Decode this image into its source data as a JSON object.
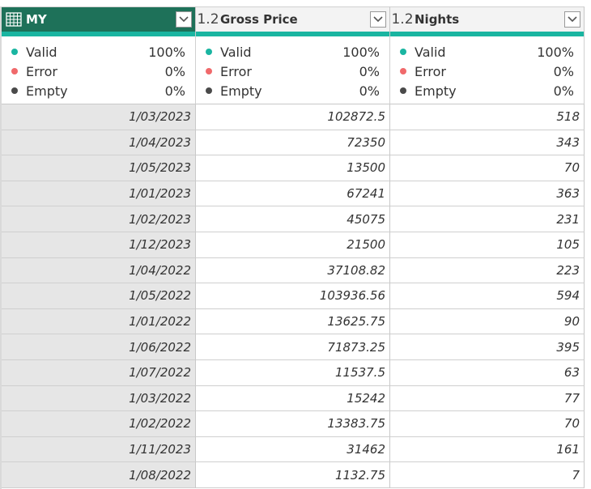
{
  "columns": [
    {
      "type_icon": "table-icon",
      "name": "MY",
      "selected": true,
      "quality": {
        "valid_label": "Valid",
        "valid": "100%",
        "error_label": "Error",
        "error": "0%",
        "empty_label": "Empty",
        "empty": "0%"
      },
      "values": [
        "1/03/2023",
        "1/04/2023",
        "1/05/2023",
        "1/01/2023",
        "1/02/2023",
        "1/12/2023",
        "1/04/2022",
        "1/05/2022",
        "1/01/2022",
        "1/06/2022",
        "1/07/2022",
        "1/03/2022",
        "1/02/2022",
        "1/11/2023",
        "1/08/2022"
      ]
    },
    {
      "type_icon": "1.2",
      "name": "Gross Price",
      "selected": false,
      "quality": {
        "valid_label": "Valid",
        "valid": "100%",
        "error_label": "Error",
        "error": "0%",
        "empty_label": "Empty",
        "empty": "0%"
      },
      "values": [
        "102872.5",
        "72350",
        "13500",
        "67241",
        "45075",
        "21500",
        "37108.82",
        "103936.56",
        "13625.75",
        "71873.25",
        "11537.5",
        "15242",
        "13383.75",
        "31462",
        "1132.75"
      ]
    },
    {
      "type_icon": "1.2",
      "name": "Nights",
      "selected": false,
      "quality": {
        "valid_label": "Valid",
        "valid": "100%",
        "error_label": "Error",
        "error": "0%",
        "empty_label": "Empty",
        "empty": "0%"
      },
      "values": [
        "518",
        "343",
        "70",
        "363",
        "231",
        "105",
        "223",
        "594",
        "90",
        "395",
        "63",
        "77",
        "70",
        "161",
        "7"
      ]
    }
  ],
  "colors": {
    "selected_header": "#1e7159",
    "quality_bar": "#1ab5a1",
    "valid_dot": "#1ab5a1",
    "error_dot": "#f0696b",
    "empty_dot": "#4a4a4a"
  }
}
